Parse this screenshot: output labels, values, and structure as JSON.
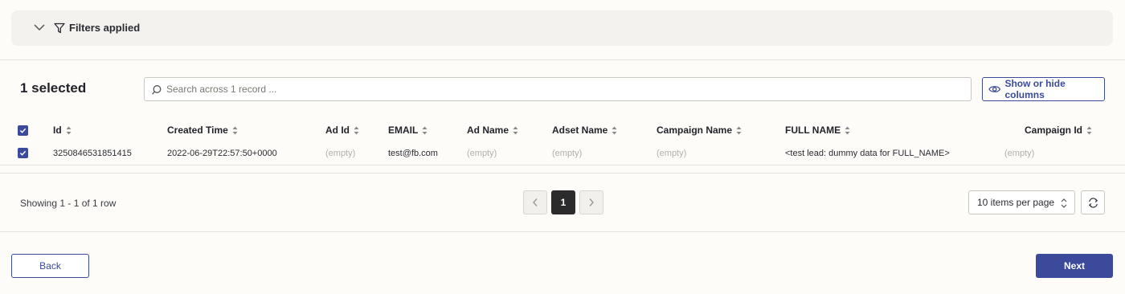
{
  "filters": {
    "label": "Filters applied"
  },
  "toolbar": {
    "selected_count": "1 selected",
    "search_placeholder": "Search across 1 record ...",
    "columns_button": "Show or hide columns"
  },
  "table": {
    "columns": [
      "Id",
      "Created Time",
      "Ad Id",
      "EMAIL",
      "Ad Name",
      "Adset Name",
      "Campaign Name",
      "FULL NAME",
      "Campaign Id"
    ],
    "rows": [
      [
        "3250846531851415",
        "2022-06-29T22:57:50+0000",
        "(empty)",
        "test@fb.com",
        "(empty)",
        "(empty)",
        "(empty)",
        "<test lead: dummy data for FULL_NAME>",
        "(empty)"
      ]
    ]
  },
  "pagination": {
    "showing": "Showing 1 - 1 of 1 row",
    "current_page": "1",
    "per_page": "10 items per page"
  },
  "footer": {
    "back": "Back",
    "next": "Next"
  },
  "colors": {
    "accent": "#3b4a9b",
    "background": "#fdfcf8",
    "panel": "#f3f2ee"
  }
}
